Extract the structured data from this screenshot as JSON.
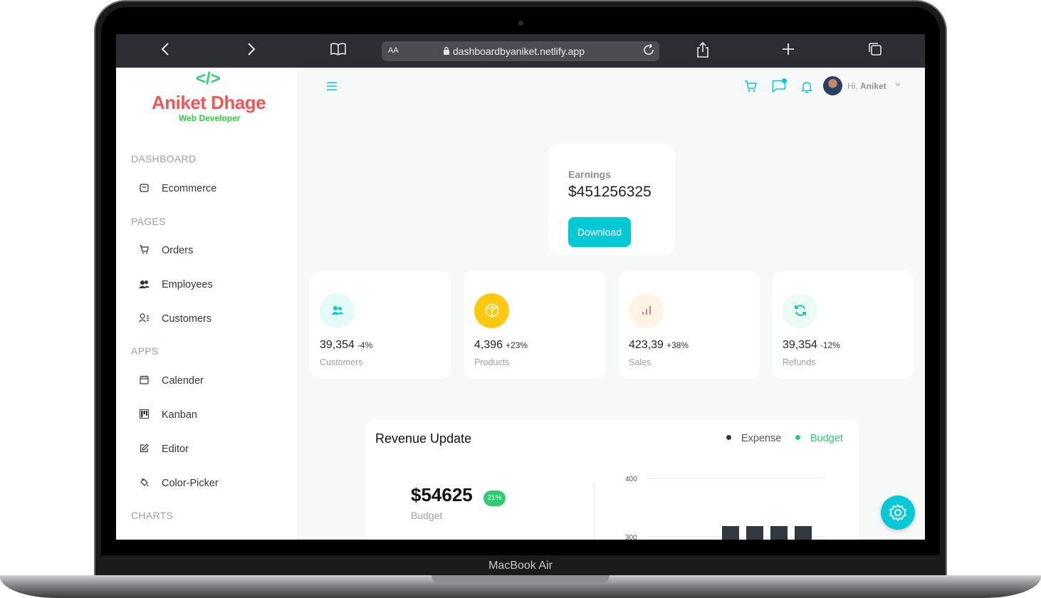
{
  "device_label": "MacBook Air",
  "browser": {
    "aa_label": "AA",
    "url": "dashboardbyaniket.netlify.app",
    "icons": [
      "chevron-left-icon",
      "chevron-right-icon",
      "book-icon",
      "lock-icon",
      "reload-icon",
      "share-icon",
      "plus-icon",
      "tabs-icon"
    ]
  },
  "logo": {
    "code": "</>",
    "name": "Aniket Dhage",
    "subtitle": "Web Developer"
  },
  "sidebar": {
    "sections": [
      {
        "title": "DASHBOARD",
        "items": [
          {
            "label": "Ecommerce",
            "icon": "shopping-bag-icon"
          }
        ]
      },
      {
        "title": "PAGES",
        "items": [
          {
            "label": "Orders",
            "icon": "cart-icon"
          },
          {
            "label": "Employees",
            "icon": "employees-icon"
          },
          {
            "label": "Customers",
            "icon": "customers-icon"
          }
        ]
      },
      {
        "title": "APPS",
        "items": [
          {
            "label": "Calender",
            "icon": "calendar-icon"
          },
          {
            "label": "Kanban",
            "icon": "kanban-icon"
          },
          {
            "label": "Editor",
            "icon": "edit-icon"
          },
          {
            "label": "Color-Picker",
            "icon": "color-picker-icon"
          }
        ]
      },
      {
        "title": "CHARTS",
        "items": []
      }
    ]
  },
  "header": {
    "greeting": "Hi,",
    "user": "Aniket",
    "accent": "#03c9d7"
  },
  "earnings": {
    "label": "Earnings",
    "value": "$451256325",
    "button": "Download"
  },
  "stats": [
    {
      "value": "39,354",
      "change": "-4%",
      "label": "Customers",
      "icon": "customers-icon",
      "icon_color": "#03c9d7",
      "bg": "#e5fafb"
    },
    {
      "value": "4,396",
      "change": "+23%",
      "label": "Products",
      "icon": "box-icon",
      "icon_color": "#ffffff",
      "bg": "#fec90f"
    },
    {
      "value": "423,39",
      "change": "+38%",
      "label": "Sales",
      "icon": "bar-chart-icon",
      "icon_color": "#e46a76",
      "bg": "#fff4e5"
    },
    {
      "value": "39,354",
      "change": "-12%",
      "label": "Refunds",
      "icon": "refresh-icon",
      "icon_color": "#00c292",
      "bg": "#ebfaf2"
    }
  ],
  "revenue": {
    "title": "Revenue Update",
    "legend": [
      {
        "label": "Expense",
        "color": "#33373e"
      },
      {
        "label": "Budget",
        "color": "#2ecc71"
      }
    ],
    "budget_amount": "$54625",
    "budget_percent": "21%",
    "budget_label": "Budget"
  },
  "chart_data": {
    "type": "bar",
    "categories": [
      "",
      "",
      "",
      ""
    ],
    "values": [
      300,
      300,
      300,
      300
    ],
    "ylim": [
      300,
      400
    ],
    "yticks": [
      "400",
      "300"
    ],
    "bar_color": "#33373e",
    "grid": true
  }
}
